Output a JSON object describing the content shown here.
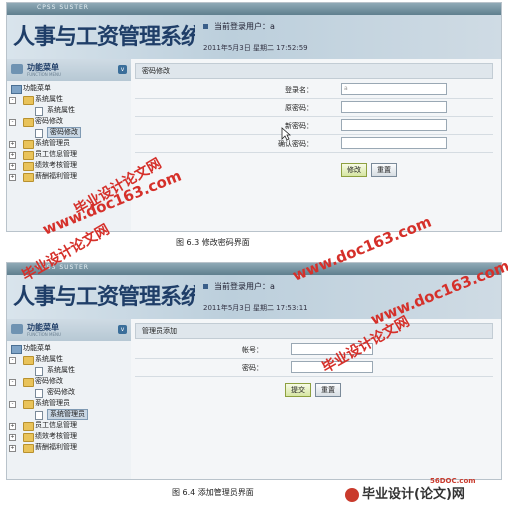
{
  "app": {
    "brand": "CPSS SUSTER",
    "title": "人事与工资管理系统",
    "menu_title": "功能菜单",
    "menu_sub": "FUNCTION MENU",
    "menu_toggle": "v"
  },
  "screens": [
    {
      "user_label": "当前登录用户：a",
      "time": "2011年5月3日  星期二  17:52:59",
      "tree": [
        {
          "label": "功能菜单",
          "level": 0,
          "icon": "pc",
          "pm": ""
        },
        {
          "label": "系统属性",
          "level": 1,
          "icon": "folder",
          "pm": "-"
        },
        {
          "label": "系统属性",
          "level": 2,
          "icon": "page",
          "pm": "",
          "selected": false
        },
        {
          "label": "密码修改",
          "level": 1,
          "icon": "folder",
          "pm": "-"
        },
        {
          "label": "密码修改",
          "level": 2,
          "icon": "page",
          "pm": "",
          "selected": true
        },
        {
          "label": "系统管理员",
          "level": 1,
          "icon": "folder",
          "pm": "+"
        },
        {
          "label": "员工信息管理",
          "level": 1,
          "icon": "folder",
          "pm": "+"
        },
        {
          "label": "绩效考核管理",
          "level": 1,
          "icon": "folder",
          "pm": "+"
        },
        {
          "label": "薪酬福利管理",
          "level": 1,
          "icon": "folder",
          "pm": "+"
        }
      ],
      "panel_title": "密码修改",
      "fields": [
        {
          "label": "登录名：",
          "value": "a"
        },
        {
          "label": "原密码：",
          "value": ""
        },
        {
          "label": "新密码：",
          "value": ""
        },
        {
          "label": "确认密码：",
          "value": ""
        }
      ],
      "buttons": [
        "修改",
        "重置"
      ],
      "caption": "图 6.3   修改密码界面"
    },
    {
      "user_label": "当前登录用户：a",
      "time": "2011年5月3日  星期二  17:53:11",
      "tree": [
        {
          "label": "功能菜单",
          "level": 0,
          "icon": "pc",
          "pm": ""
        },
        {
          "label": "系统属性",
          "level": 1,
          "icon": "folder",
          "pm": "-"
        },
        {
          "label": "系统属性",
          "level": 2,
          "icon": "page",
          "pm": "",
          "selected": false
        },
        {
          "label": "密码修改",
          "level": 1,
          "icon": "folder",
          "pm": "-"
        },
        {
          "label": "密码修改",
          "level": 2,
          "icon": "page",
          "pm": "",
          "selected": false
        },
        {
          "label": "系统管理员",
          "level": 1,
          "icon": "folder",
          "pm": "-"
        },
        {
          "label": "系统管理员",
          "level": 2,
          "icon": "page",
          "pm": "",
          "selected": true
        },
        {
          "label": "员工信息管理",
          "level": 1,
          "icon": "folder",
          "pm": "+"
        },
        {
          "label": "绩效考核管理",
          "level": 1,
          "icon": "folder",
          "pm": "+"
        },
        {
          "label": "薪酬福利管理",
          "level": 1,
          "icon": "folder",
          "pm": "+"
        }
      ],
      "panel_title": "管理员添加",
      "fields": [
        {
          "label": "帐号：",
          "value": ""
        },
        {
          "label": "密码：",
          "value": ""
        }
      ],
      "buttons": [
        "提交",
        "重置"
      ],
      "caption": "图 6.4 添加管理员界面"
    }
  ],
  "watermarks": {
    "doc163": "www.doc163.com",
    "thesis": "毕业设计论文网",
    "site": "56DOC.com",
    "logo": "毕业设计(论文)网"
  },
  "colors": {
    "accent": "#1f3e68",
    "watermark": "#d5302a"
  }
}
